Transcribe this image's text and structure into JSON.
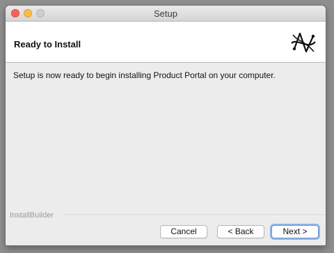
{
  "window": {
    "title": "Setup"
  },
  "header": {
    "title": "Ready to Install",
    "logo_icon": "installbuilder-logo-icon"
  },
  "content": {
    "message": "Setup is now ready to begin installing Product Portal on your computer."
  },
  "footer": {
    "brand": "InstallBuilder"
  },
  "buttons": {
    "cancel": "Cancel",
    "back": "< Back",
    "next": "Next >"
  },
  "colors": {
    "close": "#fc605c",
    "minimize": "#fdbc40",
    "zoom_disabled": "#cfcfcf",
    "focus_ring": "#8fb4e6"
  }
}
